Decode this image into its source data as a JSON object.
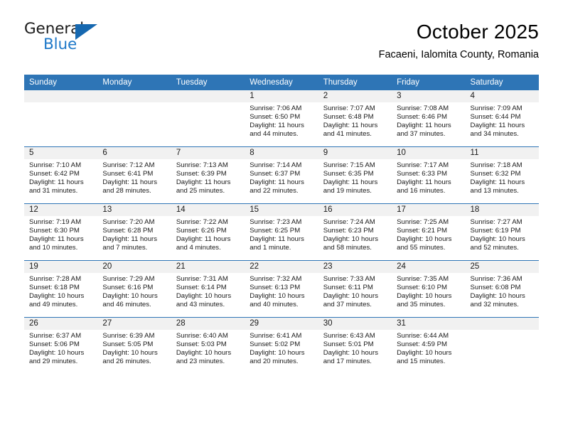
{
  "brand": {
    "name_part1": "General",
    "name_part2": "Blue",
    "logo_icon": "triangle-logo-icon"
  },
  "header": {
    "title": "October 2025",
    "subtitle": "Facaeni, Ialomita County, Romania"
  },
  "calendar": {
    "accent_color": "#2e75b6",
    "daynum_band_color": "#f1f1f1",
    "weekday_headers": [
      "Sunday",
      "Monday",
      "Tuesday",
      "Wednesday",
      "Thursday",
      "Friday",
      "Saturday"
    ],
    "labels": {
      "sunrise": "Sunrise:",
      "sunset": "Sunset:",
      "daylight": "Daylight:"
    },
    "weeks": [
      [
        {
          "empty": true
        },
        {
          "empty": true
        },
        {
          "empty": true
        },
        {
          "day": "1",
          "sunrise": "Sunrise: 7:06 AM",
          "sunset": "Sunset: 6:50 PM",
          "daylight_line1": "Daylight: 11 hours",
          "daylight_line2": "and 44 minutes."
        },
        {
          "day": "2",
          "sunrise": "Sunrise: 7:07 AM",
          "sunset": "Sunset: 6:48 PM",
          "daylight_line1": "Daylight: 11 hours",
          "daylight_line2": "and 41 minutes."
        },
        {
          "day": "3",
          "sunrise": "Sunrise: 7:08 AM",
          "sunset": "Sunset: 6:46 PM",
          "daylight_line1": "Daylight: 11 hours",
          "daylight_line2": "and 37 minutes."
        },
        {
          "day": "4",
          "sunrise": "Sunrise: 7:09 AM",
          "sunset": "Sunset: 6:44 PM",
          "daylight_line1": "Daylight: 11 hours",
          "daylight_line2": "and 34 minutes."
        }
      ],
      [
        {
          "day": "5",
          "sunrise": "Sunrise: 7:10 AM",
          "sunset": "Sunset: 6:42 PM",
          "daylight_line1": "Daylight: 11 hours",
          "daylight_line2": "and 31 minutes."
        },
        {
          "day": "6",
          "sunrise": "Sunrise: 7:12 AM",
          "sunset": "Sunset: 6:41 PM",
          "daylight_line1": "Daylight: 11 hours",
          "daylight_line2": "and 28 minutes."
        },
        {
          "day": "7",
          "sunrise": "Sunrise: 7:13 AM",
          "sunset": "Sunset: 6:39 PM",
          "daylight_line1": "Daylight: 11 hours",
          "daylight_line2": "and 25 minutes."
        },
        {
          "day": "8",
          "sunrise": "Sunrise: 7:14 AM",
          "sunset": "Sunset: 6:37 PM",
          "daylight_line1": "Daylight: 11 hours",
          "daylight_line2": "and 22 minutes."
        },
        {
          "day": "9",
          "sunrise": "Sunrise: 7:15 AM",
          "sunset": "Sunset: 6:35 PM",
          "daylight_line1": "Daylight: 11 hours",
          "daylight_line2": "and 19 minutes."
        },
        {
          "day": "10",
          "sunrise": "Sunrise: 7:17 AM",
          "sunset": "Sunset: 6:33 PM",
          "daylight_line1": "Daylight: 11 hours",
          "daylight_line2": "and 16 minutes."
        },
        {
          "day": "11",
          "sunrise": "Sunrise: 7:18 AM",
          "sunset": "Sunset: 6:32 PM",
          "daylight_line1": "Daylight: 11 hours",
          "daylight_line2": "and 13 minutes."
        }
      ],
      [
        {
          "day": "12",
          "sunrise": "Sunrise: 7:19 AM",
          "sunset": "Sunset: 6:30 PM",
          "daylight_line1": "Daylight: 11 hours",
          "daylight_line2": "and 10 minutes."
        },
        {
          "day": "13",
          "sunrise": "Sunrise: 7:20 AM",
          "sunset": "Sunset: 6:28 PM",
          "daylight_line1": "Daylight: 11 hours",
          "daylight_line2": "and 7 minutes."
        },
        {
          "day": "14",
          "sunrise": "Sunrise: 7:22 AM",
          "sunset": "Sunset: 6:26 PM",
          "daylight_line1": "Daylight: 11 hours",
          "daylight_line2": "and 4 minutes."
        },
        {
          "day": "15",
          "sunrise": "Sunrise: 7:23 AM",
          "sunset": "Sunset: 6:25 PM",
          "daylight_line1": "Daylight: 11 hours",
          "daylight_line2": "and 1 minute."
        },
        {
          "day": "16",
          "sunrise": "Sunrise: 7:24 AM",
          "sunset": "Sunset: 6:23 PM",
          "daylight_line1": "Daylight: 10 hours",
          "daylight_line2": "and 58 minutes."
        },
        {
          "day": "17",
          "sunrise": "Sunrise: 7:25 AM",
          "sunset": "Sunset: 6:21 PM",
          "daylight_line1": "Daylight: 10 hours",
          "daylight_line2": "and 55 minutes."
        },
        {
          "day": "18",
          "sunrise": "Sunrise: 7:27 AM",
          "sunset": "Sunset: 6:19 PM",
          "daylight_line1": "Daylight: 10 hours",
          "daylight_line2": "and 52 minutes."
        }
      ],
      [
        {
          "day": "19",
          "sunrise": "Sunrise: 7:28 AM",
          "sunset": "Sunset: 6:18 PM",
          "daylight_line1": "Daylight: 10 hours",
          "daylight_line2": "and 49 minutes."
        },
        {
          "day": "20",
          "sunrise": "Sunrise: 7:29 AM",
          "sunset": "Sunset: 6:16 PM",
          "daylight_line1": "Daylight: 10 hours",
          "daylight_line2": "and 46 minutes."
        },
        {
          "day": "21",
          "sunrise": "Sunrise: 7:31 AM",
          "sunset": "Sunset: 6:14 PM",
          "daylight_line1": "Daylight: 10 hours",
          "daylight_line2": "and 43 minutes."
        },
        {
          "day": "22",
          "sunrise": "Sunrise: 7:32 AM",
          "sunset": "Sunset: 6:13 PM",
          "daylight_line1": "Daylight: 10 hours",
          "daylight_line2": "and 40 minutes."
        },
        {
          "day": "23",
          "sunrise": "Sunrise: 7:33 AM",
          "sunset": "Sunset: 6:11 PM",
          "daylight_line1": "Daylight: 10 hours",
          "daylight_line2": "and 37 minutes."
        },
        {
          "day": "24",
          "sunrise": "Sunrise: 7:35 AM",
          "sunset": "Sunset: 6:10 PM",
          "daylight_line1": "Daylight: 10 hours",
          "daylight_line2": "and 35 minutes."
        },
        {
          "day": "25",
          "sunrise": "Sunrise: 7:36 AM",
          "sunset": "Sunset: 6:08 PM",
          "daylight_line1": "Daylight: 10 hours",
          "daylight_line2": "and 32 minutes."
        }
      ],
      [
        {
          "day": "26",
          "sunrise": "Sunrise: 6:37 AM",
          "sunset": "Sunset: 5:06 PM",
          "daylight_line1": "Daylight: 10 hours",
          "daylight_line2": "and 29 minutes."
        },
        {
          "day": "27",
          "sunrise": "Sunrise: 6:39 AM",
          "sunset": "Sunset: 5:05 PM",
          "daylight_line1": "Daylight: 10 hours",
          "daylight_line2": "and 26 minutes."
        },
        {
          "day": "28",
          "sunrise": "Sunrise: 6:40 AM",
          "sunset": "Sunset: 5:03 PM",
          "daylight_line1": "Daylight: 10 hours",
          "daylight_line2": "and 23 minutes."
        },
        {
          "day": "29",
          "sunrise": "Sunrise: 6:41 AM",
          "sunset": "Sunset: 5:02 PM",
          "daylight_line1": "Daylight: 10 hours",
          "daylight_line2": "and 20 minutes."
        },
        {
          "day": "30",
          "sunrise": "Sunrise: 6:43 AM",
          "sunset": "Sunset: 5:01 PM",
          "daylight_line1": "Daylight: 10 hours",
          "daylight_line2": "and 17 minutes."
        },
        {
          "day": "31",
          "sunrise": "Sunrise: 6:44 AM",
          "sunset": "Sunset: 4:59 PM",
          "daylight_line1": "Daylight: 10 hours",
          "daylight_line2": "and 15 minutes."
        },
        {
          "empty": true
        }
      ]
    ]
  }
}
